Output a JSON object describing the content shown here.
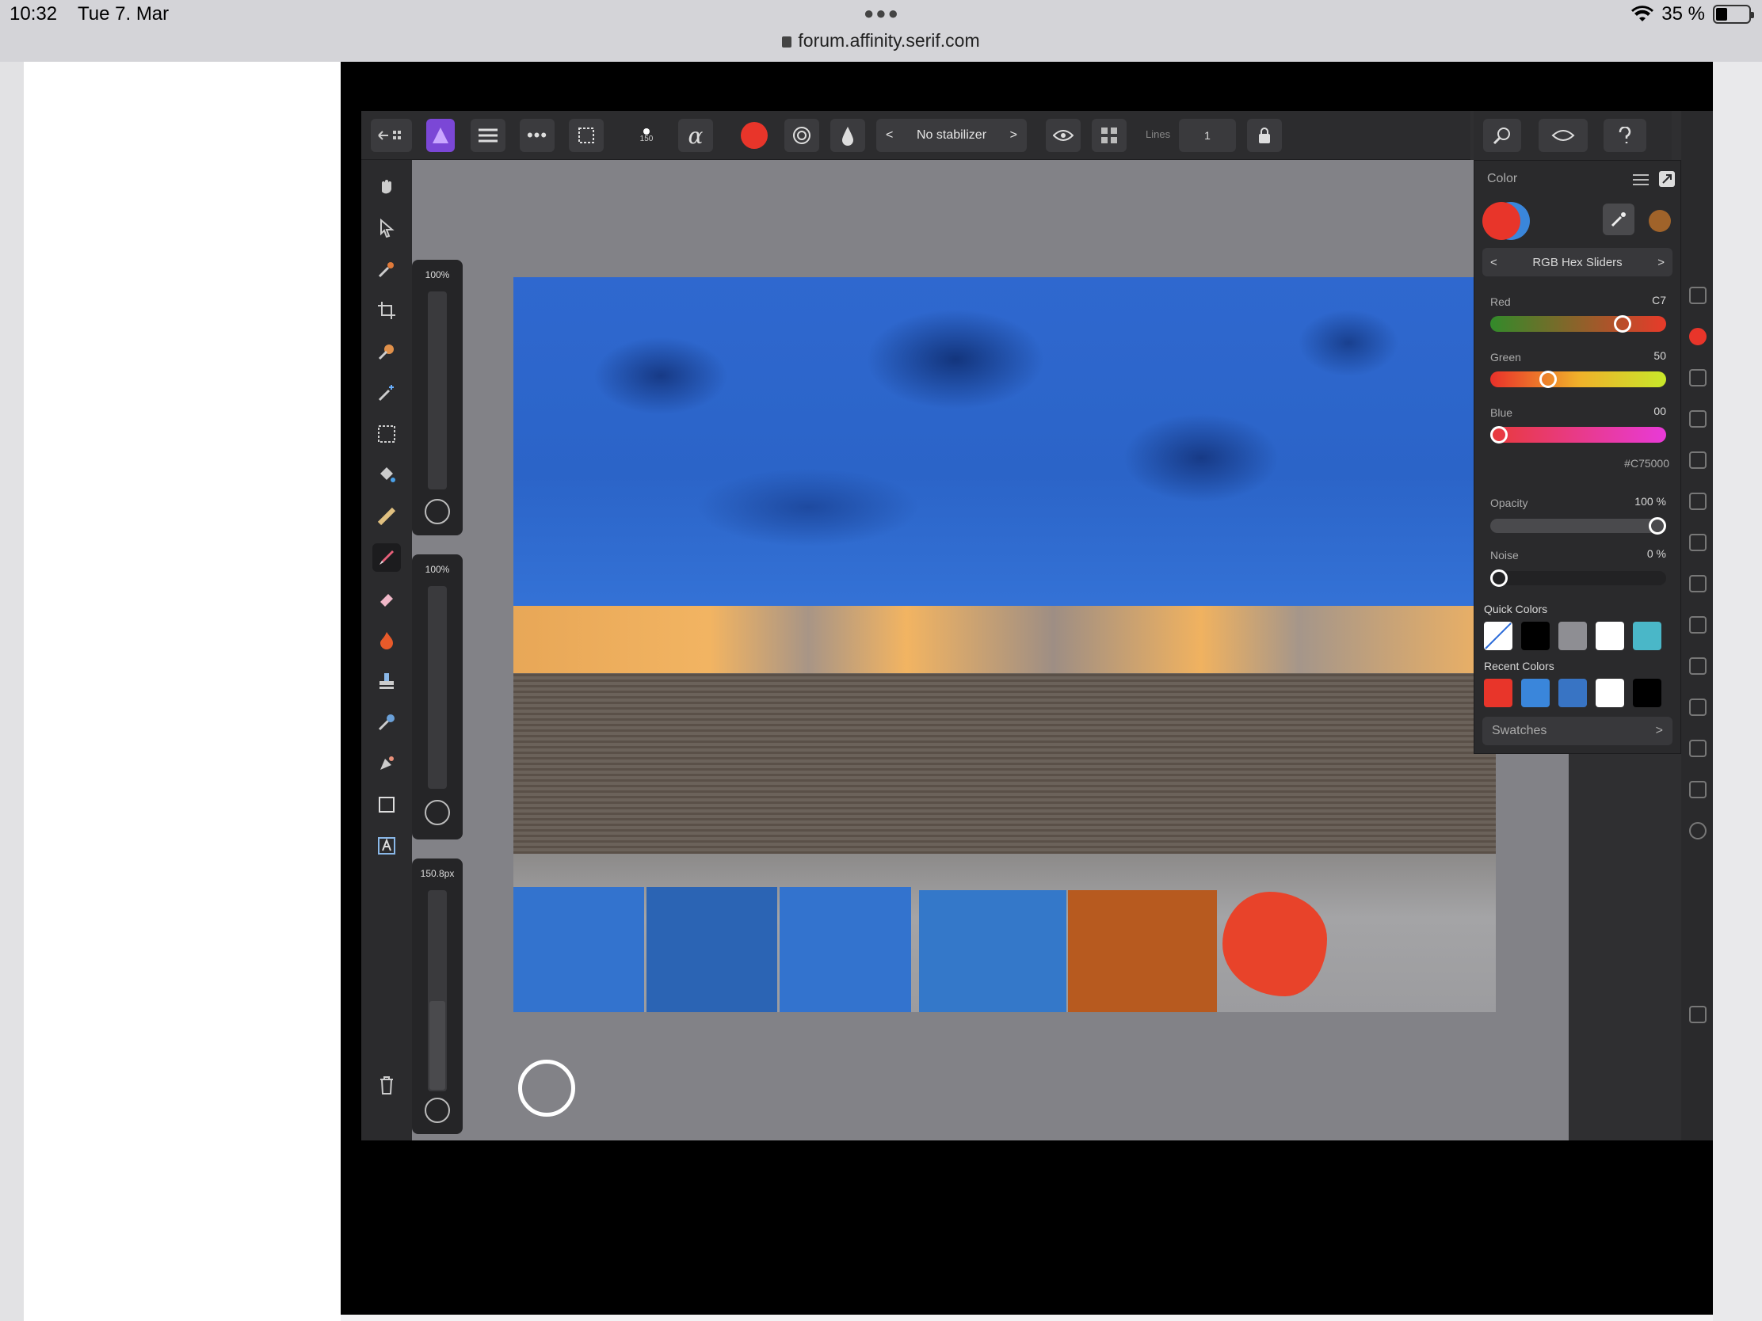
{
  "status_bar": {
    "time": "10:32",
    "date": "Tue 7. Mar",
    "url": "forum.affinity.serif.com",
    "battery": "35 %"
  },
  "toolbar": {
    "brush_size": "150",
    "stabilizer": "No stabilizer",
    "lines_label": "Lines",
    "lines_value": "1",
    "current_color": "#e8352a"
  },
  "sliders": {
    "opacity_label": "100%",
    "flow_label": "100%",
    "width_label": "150.8px"
  },
  "panel": {
    "title": "Color",
    "mode": "RGB Hex Sliders",
    "red": {
      "label": "Red",
      "value": "C7"
    },
    "green": {
      "label": "Green",
      "value": "50"
    },
    "blue": {
      "label": "Blue",
      "value": "00"
    },
    "hex": "#C75000",
    "opacity": {
      "label": "Opacity",
      "value": "100 %"
    },
    "noise": {
      "label": "Noise",
      "value": "0 %"
    },
    "quick_label": "Quick Colors",
    "quick_colors": [
      "none",
      "#000000",
      "#8e8e93",
      "#ffffff",
      "#4ab7c8"
    ],
    "recent_label": "Recent Colors",
    "recent_colors": [
      "#e8352a",
      "#3a86db",
      "#3874c4",
      "#ffffff",
      "#000000"
    ],
    "swatches": "Swatches"
  },
  "canvas_chips": [
    "#3373ce",
    "#2b64b4",
    "#3373ce",
    "#3478c9",
    "#b75a1f"
  ],
  "slider_levels": {
    "red": 0.78,
    "green": 0.31,
    "blue": 0.0,
    "opacity": 1.0,
    "noise": 0.0
  }
}
